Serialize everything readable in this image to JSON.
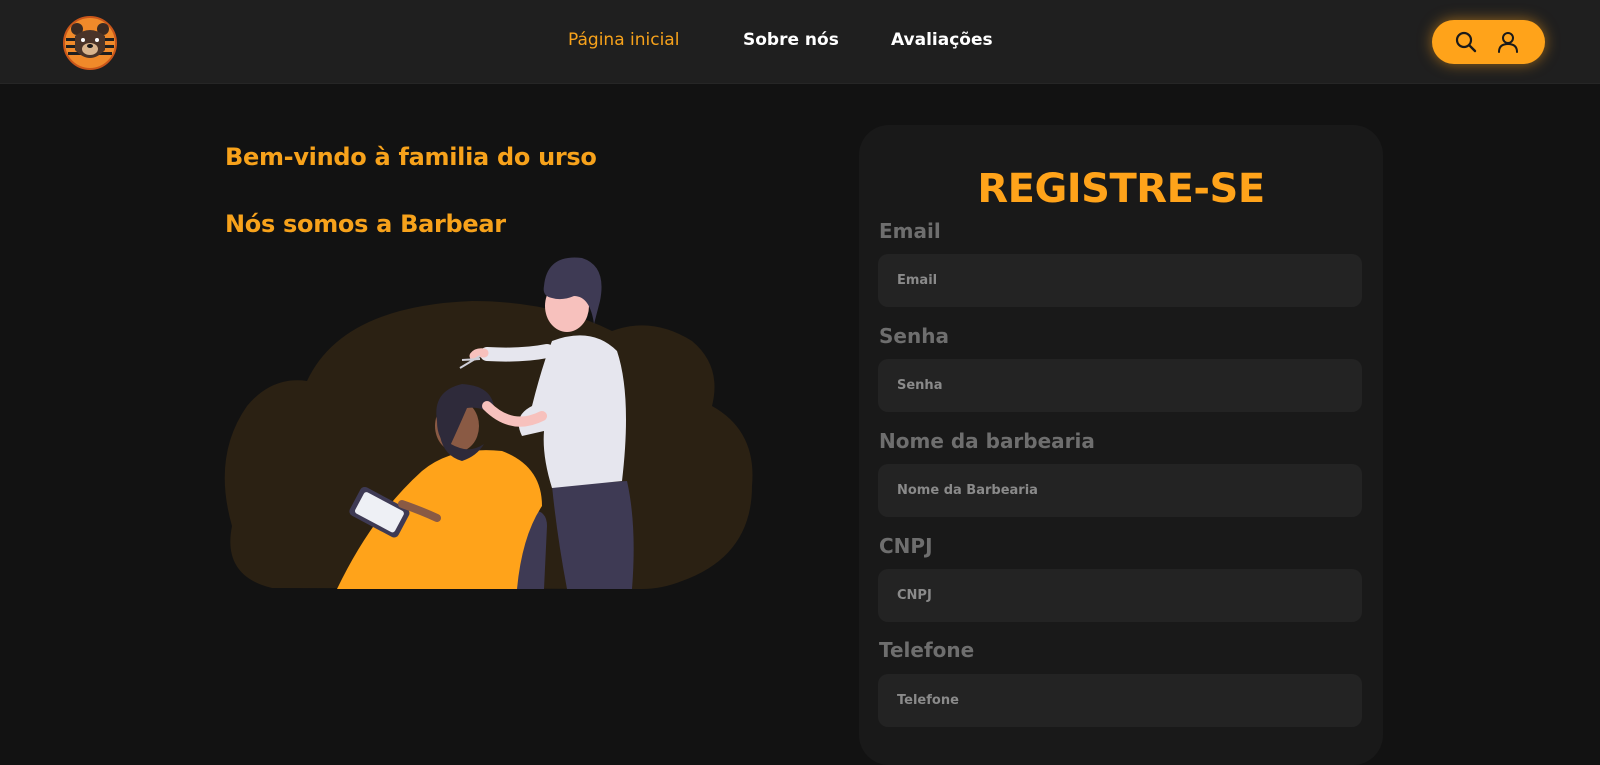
{
  "header": {
    "logo_icon": "bear-logo-icon",
    "nav": [
      {
        "label": "Página inicial",
        "active": true
      },
      {
        "label": "Sobre nós",
        "active": false
      },
      {
        "label": "Avaliações",
        "active": false
      }
    ],
    "actions": {
      "search_icon": "search-icon",
      "user_icon": "user-icon"
    }
  },
  "hero": {
    "line1": "Bem-vindo à familia do urso",
    "line2": "Nós somos a Barbear",
    "illustration": "barber-cutting-hair-illustration"
  },
  "register": {
    "title": "REGISTRE-SE",
    "fields": [
      {
        "label": "Email",
        "placeholder": "Email"
      },
      {
        "label": "Senha",
        "placeholder": "Senha"
      },
      {
        "label": "Nome da barbearia",
        "placeholder": "Nome da Barbearia"
      },
      {
        "label": "CNPJ",
        "placeholder": "CNPJ"
      },
      {
        "label": "Telefone",
        "placeholder": "Telefone"
      }
    ]
  },
  "colors": {
    "accent": "#ffa31a",
    "background": "#121212",
    "header": "#1f1f1f",
    "card": "#191919",
    "input": "#232323"
  }
}
